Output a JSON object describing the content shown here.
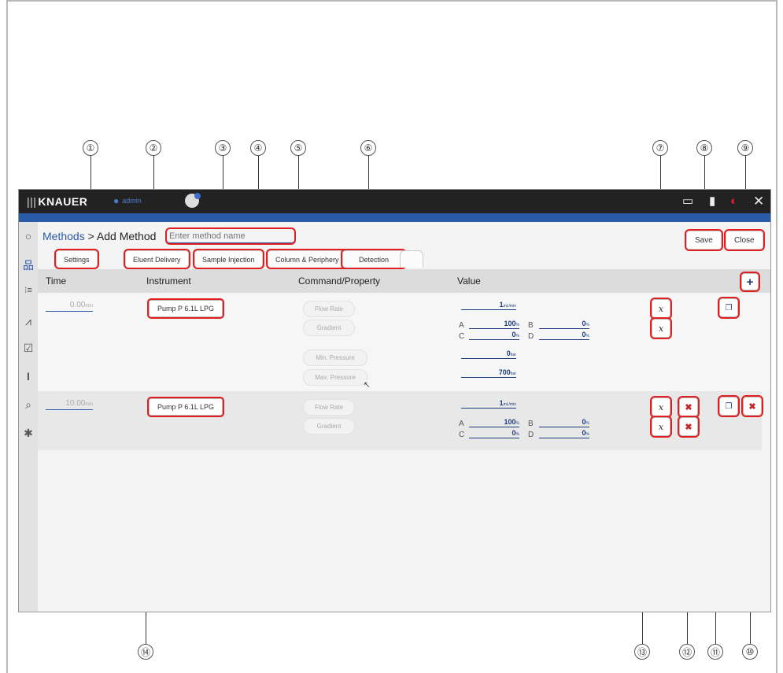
{
  "callouts": [
    "①",
    "②",
    "③",
    "④",
    "⑤",
    "⑥",
    "⑦",
    "⑧",
    "⑨",
    "⑩",
    "⑪",
    "⑫",
    "⑬",
    "⑭"
  ],
  "app": {
    "brand": "KNAUER",
    "user": "admin",
    "icons": {
      "brand": "knauer-logo-icon",
      "user": "user-icon",
      "notifications": "bell-icon",
      "monitor": "monitor-icon",
      "device": "device-icon",
      "power": "power-icon",
      "close": "close-icon"
    },
    "close_glyph": "✕"
  },
  "sidebar": {
    "items": [
      "circle-icon",
      "method-tree-icon",
      "sequence-icon",
      "chart-icon",
      "checkbox-icon",
      "cursor-text-icon",
      "search-doc-icon",
      "gear-icon"
    ],
    "glyphs": [
      "○",
      "品",
      "⁝≡",
      "⩘",
      "☑",
      "I",
      "⌕",
      "✱"
    ]
  },
  "breadcrumb": {
    "root": "Methods",
    "sep": ">",
    "current": "Add Method"
  },
  "method_name": {
    "placeholder": "Enter method name"
  },
  "toolbar": {
    "save": "Save",
    "close": "Close"
  },
  "tabs": [
    "Settings",
    "Eluent Delivery",
    "Sample Injection",
    "Column & Periphery",
    "Detection"
  ],
  "table": {
    "headers": {
      "time": "Time",
      "instrument": "Instrument",
      "command": "Command/Property",
      "value": "Value"
    },
    "add_glyph": "+",
    "rows": [
      {
        "time": "0.00",
        "time_unit": "min",
        "instrument": "Pump P 6.1L LPG",
        "commands": [
          "Flow Rate",
          "Gradient",
          "Min. Pressure",
          "Max. Pressure"
        ],
        "flow": "1",
        "flow_unit": "mL/min",
        "A": "100",
        "B": "0",
        "C": "0",
        "D": "0",
        "min_pressure": "0",
        "pressure_unit": "bar",
        "max_pressure": "700"
      },
      {
        "time": "10.00",
        "time_unit": "min",
        "instrument": "Pump P 6.1L LPG",
        "commands": [
          "Flow Rate",
          "Gradient"
        ],
        "flow": "1",
        "flow_unit": "mL/min",
        "A": "100",
        "B": "0",
        "C": "0",
        "D": "0"
      }
    ],
    "letters": {
      "A": "A",
      "B": "B",
      "C": "C",
      "D": "D"
    },
    "pct": "%",
    "x_glyph": "x",
    "del_glyph": "✖",
    "dup_glyph": "❐"
  },
  "colors": {
    "accent": "#2a5ba8",
    "highlight": "#e02020",
    "topbar": "#222222"
  }
}
